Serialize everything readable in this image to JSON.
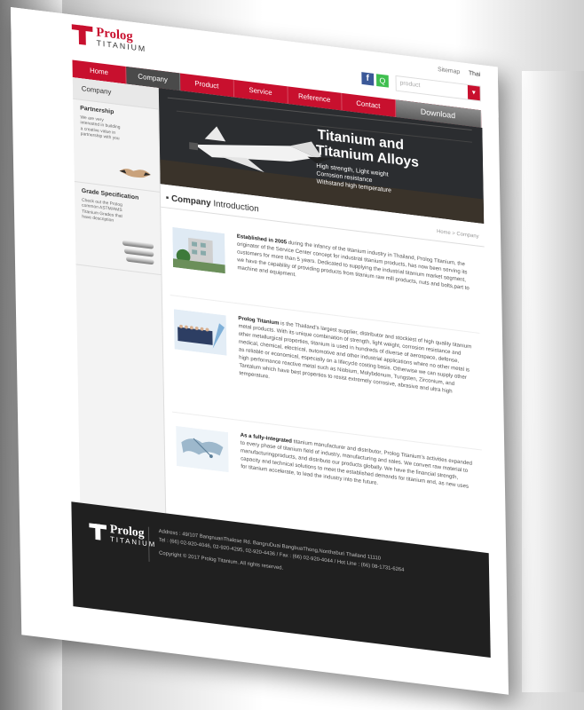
{
  "toplinks": {
    "sitemap": "Sitemap",
    "lang": "Thai"
  },
  "search": {
    "placeholder": "product"
  },
  "brand": {
    "name": "Prolog",
    "sub": "TITANIUM"
  },
  "nav": [
    "Home",
    "Company",
    "Product",
    "Service",
    "Reference",
    "Contact"
  ],
  "download_label": "Download",
  "sidebar": {
    "title": "Company",
    "partnership": {
      "title": "Partnership",
      "text": "We are very interested in building a creative value in partnership with you"
    },
    "grade": {
      "title": "Grade Specification",
      "text": "Check out the Prolog common ASTM/AMS Titanium Grades that have description"
    }
  },
  "banner": {
    "title1": "Titanium and",
    "title2": "Titanium Alloys",
    "features": [
      "High strength, Light weight",
      "Corrosion resistance",
      "Withstand high temperature"
    ]
  },
  "section_title": {
    "bold": "Company",
    "rest": "Introduction"
  },
  "breadcrumb": "Home > Company",
  "sections": [
    {
      "bold": "Established in 2005",
      "text": " during the infancy of the titanium industry in Thailand, Prolog Titanium, the originator of the Service Center concept for industrial titanium products, has now been serving its customers for more than 5 years. Dedicated to supplying the industrial titanium market segment, we have the capability of providing products from titanium raw mill products, nuts and bolts,part to machine and equipment."
    },
    {
      "bold": "Prolog Titanium",
      "text": " is the Thailand's largest supplier, distributor and stockiest of high quality titanium metal products. With its unique combination of strength, light weight, corrosion resistance and other metallurgical properties, titanium is used in hundreds of diverse of aerospace, defense, medical, chemical, electrical, automotive and other industrial applications where no other metal is as reliable or economical, especially on a lifecycle costing basis. Otherwise we can supply other high performance reactive metal such as Niobium, Molybdenum, Tungsten, Zirconium, and Tantalum which have best properties to resist extremely corrosive, abrasive and ultra high temperature."
    },
    {
      "bold": "As a fully-integrated",
      "text": " titanium manufacturer and distributor, Prolog Titanium's activities expanded to every phase of titanium field of industry, manufacturing and sales. We convert raw material to manufacturingproducts, and distribute our products globally. We have the financial strength, capacity and technical solutions to meet the established demands for titanium and, as new uses for titanium accelerate, to lead the industry into the future."
    }
  ],
  "footer": {
    "address": "Address : 49/107 BangnuanThalese Rd. BangruDuai BangbuaThong,Nonthaburi Thailand 11110",
    "tel": "Tel : (66) 02-920-4046, 02-920-4295, 02-920-4436  /  Fax : (66) 02-920-4044  /  Hot Line : (66) 08-1731-6264",
    "copyright": "Copyright © 2017 Prolog Titanium. All rights reserved."
  }
}
